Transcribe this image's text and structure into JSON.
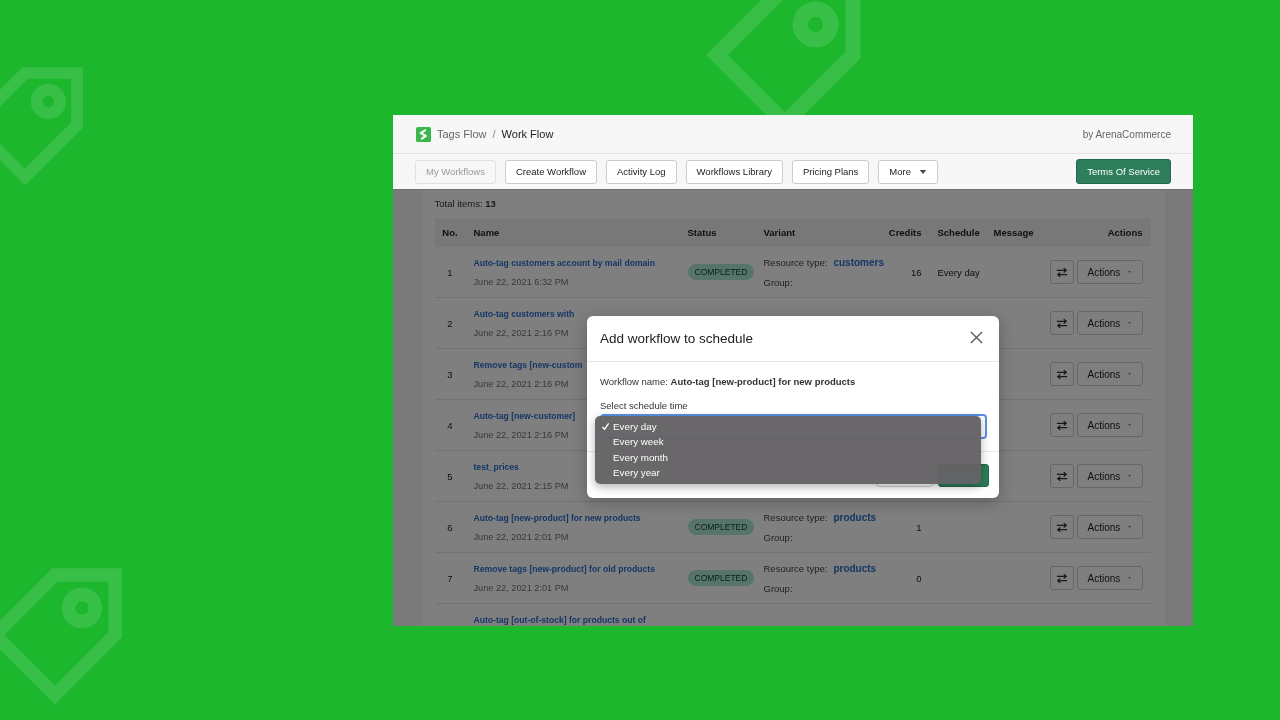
{
  "app": {
    "breadcrumb": {
      "parent": "Tags Flow",
      "separator": "/",
      "current": "Work Flow"
    },
    "vendor": "by ArenaCommerce"
  },
  "nav": [
    {
      "label": "My Workflows",
      "disabled": true,
      "kind": "plain"
    },
    {
      "label": "Create Workflow",
      "disabled": false,
      "kind": "plain"
    },
    {
      "label": "Activity Log",
      "disabled": false,
      "kind": "plain"
    },
    {
      "label": "Workflows Library",
      "disabled": false,
      "kind": "plain"
    },
    {
      "label": "Pricing Plans",
      "disabled": false,
      "kind": "plain"
    },
    {
      "label": "More",
      "disabled": false,
      "kind": "menu"
    },
    {
      "label": "Terms Of Service",
      "disabled": false,
      "kind": "primary"
    }
  ],
  "total": {
    "label": "Total items:",
    "value": "13"
  },
  "table": {
    "columns": [
      "No.",
      "Name",
      "Status",
      "Variant",
      "Credits",
      "Schedule",
      "Message",
      "Actions"
    ],
    "rows": [
      {
        "no": "1",
        "name": "Auto-tag customers account by mail domain",
        "date": "June 22, 2021 6:32 PM",
        "status": "COMPLETED",
        "resource_label": "Resource type:",
        "resource": "customers",
        "group_label": "Group:",
        "credits": "16",
        "schedule": "Every day",
        "action": "Actions"
      },
      {
        "no": "2",
        "name": "Auto-tag customers with",
        "date": "June 22, 2021 2:16 PM",
        "action": "Actions"
      },
      {
        "no": "3",
        "name": "Remove tags [new-custom",
        "date": "June 22, 2021 2:16 PM",
        "action": "Actions"
      },
      {
        "no": "4",
        "name": "Auto-tag [new-customer]",
        "date": "June 22, 2021 2:16 PM",
        "action": "Actions"
      },
      {
        "no": "5",
        "name": "test_prices",
        "date": "June 22, 2021 2:15 PM",
        "action": "Actions"
      },
      {
        "no": "6",
        "name": "Auto-tag [new-product] for new products",
        "date": "June 22, 2021 2:01 PM",
        "status": "COMPLETED",
        "resource_label": "Resource type:",
        "resource": "products",
        "group_label": "Group:",
        "credits": "1",
        "action": "Actions"
      },
      {
        "no": "7",
        "name": "Remove tags [new-product] for old products",
        "date": "June 22, 2021 2:01 PM",
        "status": "COMPLETED",
        "resource_label": "Resource type:",
        "resource": "products",
        "group_label": "Group:",
        "credits": "0",
        "action": "Actions"
      },
      {
        "name": "Auto-tag [out-of-stock] for products out of"
      }
    ]
  },
  "modal": {
    "title": "Add workflow to schedule",
    "workflow_name": "Workflow name: **Auto-tag [new-product] for new products**",
    "select_label": "Select schedule time",
    "options": [
      {
        "label": "Every day",
        "selected": true
      },
      {
        "label": "Every week",
        "selected": false
      },
      {
        "label": "Every month",
        "selected": false
      },
      {
        "label": "Every year",
        "selected": false
      }
    ],
    "footer_buttons": [
      {
        "kind": "secondary"
      },
      {
        "kind": "primary"
      }
    ]
  }
}
